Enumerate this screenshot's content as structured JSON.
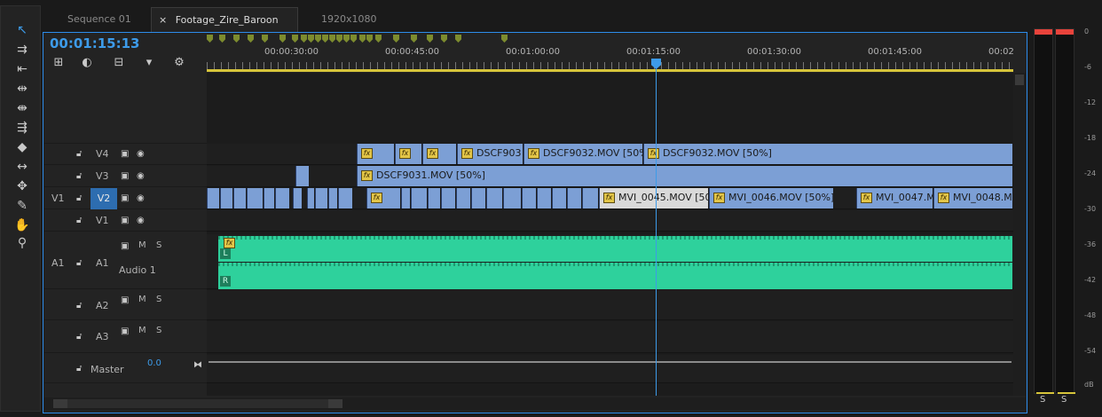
{
  "tabs": [
    {
      "label": "Sequence 01"
    },
    {
      "label": "Footage_Zire_Baroon",
      "close": "×",
      "menu": "≡"
    },
    {
      "label": "1920x1080"
    }
  ],
  "timecode": "00:01:15:13",
  "ruler": {
    "labels": [
      "00:00:30:00",
      "00:00:45:00",
      "00:01:00:00",
      "00:01:15:00",
      "00:01:30:00",
      "00:01:45:00",
      "00:02"
    ]
  },
  "tracks": {
    "video": [
      {
        "name": "V4"
      },
      {
        "name": "V3"
      },
      {
        "name": "V2",
        "source": "V1"
      },
      {
        "name": "V1"
      }
    ],
    "audio": [
      {
        "name": "A1",
        "source": "A1",
        "label": "Audio 1",
        "m": "M",
        "s": "S",
        "left_channel": "L",
        "right_channel": "R"
      },
      {
        "name": "A2",
        "m": "M",
        "s": "S"
      },
      {
        "name": "A3",
        "m": "M",
        "s": "S"
      }
    ],
    "master": {
      "label": "Master",
      "value": "0.0"
    }
  },
  "clips": {
    "v4": [
      "DSCF903",
      "DSCF9032.MOV [50%",
      "DSCF9032.MOV [50%]"
    ],
    "v3": [
      "DSCF9031.MOV [50%]"
    ],
    "v2": [
      "MVI_0045.MOV [50",
      "MVI_0046.MOV [50%]",
      "MVI_0047.M",
      "MVI_0048.M"
    ]
  },
  "fx_label": "fx",
  "meters": {
    "scale": [
      "0",
      "-6",
      "-12",
      "-18",
      "-24",
      "-30",
      "-36",
      "-42",
      "-48",
      "-54",
      "dB"
    ],
    "solo_left": "S",
    "solo_right": "S"
  },
  "colors": {
    "accent": "#3d9be9",
    "clip_video": "#7c9fd5",
    "clip_audio": "#2ed19c",
    "fx_badge": "#e2c548",
    "work_area": "#d6c43a",
    "peak": "#e8433b"
  }
}
